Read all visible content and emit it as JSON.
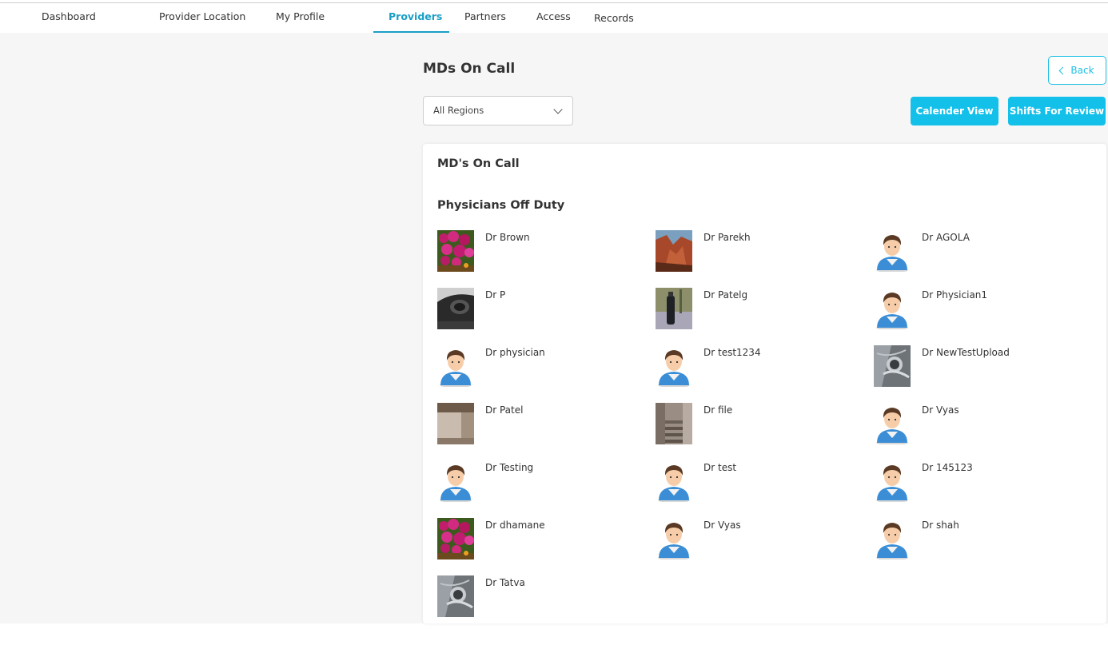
{
  "nav": {
    "items": [
      {
        "label": "Dashboard",
        "name": "nav-dashboard",
        "active": false
      },
      {
        "label": "Provider Location",
        "name": "nav-provider-location",
        "active": false
      },
      {
        "label": "My Profile",
        "name": "nav-my-profile",
        "active": false
      },
      {
        "label": "Providers",
        "name": "nav-providers",
        "active": true
      },
      {
        "label": "Partners",
        "name": "nav-partners",
        "active": false
      },
      {
        "label": "Access",
        "name": "nav-access",
        "active": false
      },
      {
        "label": "Records",
        "name": "nav-records",
        "active": false
      }
    ],
    "accent_color": "#1a9fc7"
  },
  "page": {
    "title": "MDs On Call",
    "back_label": "Back",
    "region_select": {
      "selected": "All Regions"
    },
    "calendar_view_label": "Calender View",
    "shifts_review_label": "Shifts For Review",
    "button_color": "#13c0ea"
  },
  "card": {
    "on_call_title": "MD's On Call",
    "off_duty_title": "Physicians Off Duty",
    "physicians": [
      {
        "name": "Dr Brown",
        "avatar": "flowers-photo"
      },
      {
        "name": "Dr Parekh",
        "avatar": "canyon-photo"
      },
      {
        "name": "Dr AGOLA",
        "avatar": "default-user"
      },
      {
        "name": "Dr P",
        "avatar": "dark-object-photo"
      },
      {
        "name": "Dr Patelg",
        "avatar": "bottle-photo"
      },
      {
        "name": "Dr Physician1",
        "avatar": "default-user"
      },
      {
        "name": "Dr physician",
        "avatar": "default-user"
      },
      {
        "name": "Dr test1234",
        "avatar": "default-user"
      },
      {
        "name": "Dr NewTestUpload",
        "avatar": "car-emblem-photo"
      },
      {
        "name": "Dr Patel",
        "avatar": "room-photo"
      },
      {
        "name": "Dr file",
        "avatar": "stairs-photo"
      },
      {
        "name": "Dr Vyas",
        "avatar": "default-user"
      },
      {
        "name": "Dr Testing",
        "avatar": "default-user"
      },
      {
        "name": "Dr test",
        "avatar": "default-user"
      },
      {
        "name": "Dr 145123",
        "avatar": "default-user"
      },
      {
        "name": "Dr dhamane",
        "avatar": "flowers-photo"
      },
      {
        "name": "Dr Vyas",
        "avatar": "default-user"
      },
      {
        "name": "Dr shah",
        "avatar": "default-user"
      },
      {
        "name": "Dr Tatva",
        "avatar": "car-emblem-photo"
      }
    ]
  }
}
